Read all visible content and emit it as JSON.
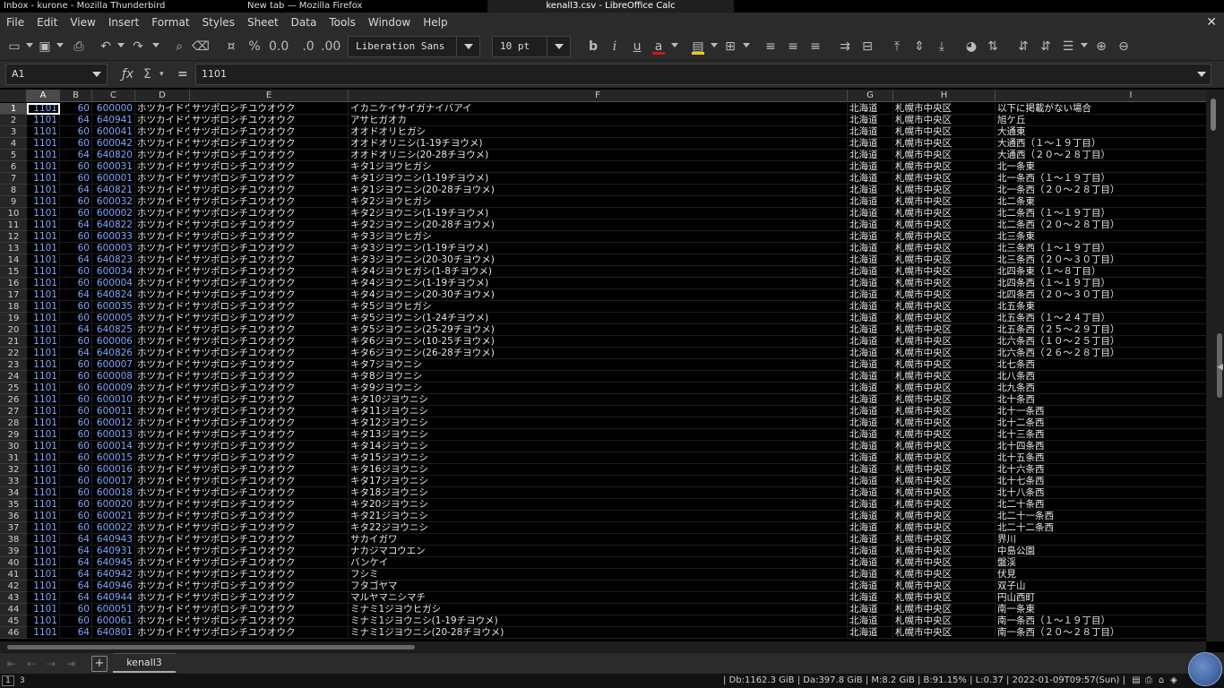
{
  "taskbar": {
    "t1": "Inbox - kurone - Mozilla Thunderbird",
    "t2": "New tab — Mozilla Firefox",
    "t3": "kenall3.csv - LibreOffice Calc"
  },
  "menu": [
    "File",
    "Edit",
    "View",
    "Insert",
    "Format",
    "Styles",
    "Sheet",
    "Data",
    "Tools",
    "Window",
    "Help"
  ],
  "close_glyph": "✕",
  "toolbar": {
    "font_name": "Liberation Sans",
    "font_size": "10 pt",
    "font_color_bar": "#d01616",
    "highlight_bar": "#e6d500"
  },
  "formula": {
    "cell_ref": "A1",
    "fx": "ƒx",
    "sigma": "Σ",
    "eq": "=",
    "value": "1101"
  },
  "columns": [
    "A",
    "B",
    "C",
    "D",
    "E",
    "F",
    "G",
    "H",
    "I"
  ],
  "rows": [
    [
      "1",
      "1101",
      "60",
      "600000",
      "ホツカイドウ",
      "サツポロシチユウオウク",
      "イカニケイサイガナイバアイ",
      "北海道",
      "札幌市中央区",
      "以下に掲載がない場合"
    ],
    [
      "2",
      "1101",
      "64",
      "640941",
      "ホツカイドウ",
      "サツポロシチユウオウク",
      "アサヒガオカ",
      "北海道",
      "札幌市中央区",
      "旭ケ丘"
    ],
    [
      "3",
      "1101",
      "60",
      "600041",
      "ホツカイドウ",
      "サツポロシチユウオウク",
      "オオドオリヒガシ",
      "北海道",
      "札幌市中央区",
      "大通東"
    ],
    [
      "4",
      "1101",
      "60",
      "600042",
      "ホツカイドウ",
      "サツポロシチユウオウク",
      "オオドオリニシ(1-19チヨウメ)",
      "北海道",
      "札幌市中央区",
      "大通西（１〜１９丁目）"
    ],
    [
      "5",
      "1101",
      "64",
      "640820",
      "ホツカイドウ",
      "サツポロシチユウオウク",
      "オオドオリニシ(20-28チヨウメ)",
      "北海道",
      "札幌市中央区",
      "大通西（２０〜２８丁目）"
    ],
    [
      "6",
      "1101",
      "60",
      "600031",
      "ホツカイドウ",
      "サツポロシチユウオウク",
      "キタ1ジヨウヒガシ",
      "北海道",
      "札幌市中央区",
      "北一条東"
    ],
    [
      "7",
      "1101",
      "60",
      "600001",
      "ホツカイドウ",
      "サツポロシチユウオウク",
      "キタ1ジヨウニシ(1-19チヨウメ)",
      "北海道",
      "札幌市中央区",
      "北一条西（１〜１９丁目）"
    ],
    [
      "8",
      "1101",
      "64",
      "640821",
      "ホツカイドウ",
      "サツポロシチユウオウク",
      "キタ1ジヨウニシ(20-28チヨウメ)",
      "北海道",
      "札幌市中央区",
      "北一条西（２０〜２８丁目）"
    ],
    [
      "9",
      "1101",
      "60",
      "600032",
      "ホツカイドウ",
      "サツポロシチユウオウク",
      "キタ2ジヨウヒガシ",
      "北海道",
      "札幌市中央区",
      "北二条東"
    ],
    [
      "10",
      "1101",
      "60",
      "600002",
      "ホツカイドウ",
      "サツポロシチユウオウク",
      "キタ2ジヨウニシ(1-19チヨウメ)",
      "北海道",
      "札幌市中央区",
      "北二条西（１〜１９丁目）"
    ],
    [
      "11",
      "1101",
      "64",
      "640822",
      "ホツカイドウ",
      "サツポロシチユウオウク",
      "キタ2ジヨウニシ(20-28チヨウメ)",
      "北海道",
      "札幌市中央区",
      "北二条西（２０〜２８丁目）"
    ],
    [
      "12",
      "1101",
      "60",
      "600033",
      "ホツカイドウ",
      "サツポロシチユウオウク",
      "キタ3ジヨウヒガシ",
      "北海道",
      "札幌市中央区",
      "北三条東"
    ],
    [
      "13",
      "1101",
      "60",
      "600003",
      "ホツカイドウ",
      "サツポロシチユウオウク",
      "キタ3ジヨウニシ(1-19チヨウメ)",
      "北海道",
      "札幌市中央区",
      "北三条西（１〜１９丁目）"
    ],
    [
      "14",
      "1101",
      "64",
      "640823",
      "ホツカイドウ",
      "サツポロシチユウオウク",
      "キタ3ジヨウニシ(20-30チヨウメ)",
      "北海道",
      "札幌市中央区",
      "北三条西（２０〜３０丁目）"
    ],
    [
      "15",
      "1101",
      "60",
      "600034",
      "ホツカイドウ",
      "サツポロシチユウオウク",
      "キタ4ジヨウヒガシ(1-8チヨウメ)",
      "北海道",
      "札幌市中央区",
      "北四条東（１〜８丁目）"
    ],
    [
      "16",
      "1101",
      "60",
      "600004",
      "ホツカイドウ",
      "サツポロシチユウオウク",
      "キタ4ジヨウニシ(1-19チヨウメ)",
      "北海道",
      "札幌市中央区",
      "北四条西（１〜１９丁目）"
    ],
    [
      "17",
      "1101",
      "64",
      "640824",
      "ホツカイドウ",
      "サツポロシチユウオウク",
      "キタ4ジヨウニシ(20-30チヨウメ)",
      "北海道",
      "札幌市中央区",
      "北四条西（２０〜３０丁目）"
    ],
    [
      "18",
      "1101",
      "60",
      "600035",
      "ホツカイドウ",
      "サツポロシチユウオウク",
      "キタ5ジヨウヒガシ",
      "北海道",
      "札幌市中央区",
      "北五条東"
    ],
    [
      "19",
      "1101",
      "60",
      "600005",
      "ホツカイドウ",
      "サツポロシチユウオウク",
      "キタ5ジヨウニシ(1-24チヨウメ)",
      "北海道",
      "札幌市中央区",
      "北五条西（１〜２４丁目）"
    ],
    [
      "20",
      "1101",
      "64",
      "640825",
      "ホツカイドウ",
      "サツポロシチユウオウク",
      "キタ5ジヨウニシ(25-29チヨウメ)",
      "北海道",
      "札幌市中央区",
      "北五条西（２５〜２９丁目）"
    ],
    [
      "21",
      "1101",
      "60",
      "600006",
      "ホツカイドウ",
      "サツポロシチユウオウク",
      "キタ6ジヨウニシ(10-25チヨウメ)",
      "北海道",
      "札幌市中央区",
      "北六条西（１０〜２５丁目）"
    ],
    [
      "22",
      "1101",
      "64",
      "640826",
      "ホツカイドウ",
      "サツポロシチユウオウク",
      "キタ6ジヨウニシ(26-28チヨウメ)",
      "北海道",
      "札幌市中央区",
      "北六条西（２６〜２８丁目）"
    ],
    [
      "23",
      "1101",
      "60",
      "600007",
      "ホツカイドウ",
      "サツポロシチユウオウク",
      "キタ7ジヨウニシ",
      "北海道",
      "札幌市中央区",
      "北七条西"
    ],
    [
      "24",
      "1101",
      "60",
      "600008",
      "ホツカイドウ",
      "サツポロシチユウオウク",
      "キタ8ジヨウニシ",
      "北海道",
      "札幌市中央区",
      "北八条西"
    ],
    [
      "25",
      "1101",
      "60",
      "600009",
      "ホツカイドウ",
      "サツポロシチユウオウク",
      "キタ9ジヨウニシ",
      "北海道",
      "札幌市中央区",
      "北九条西"
    ],
    [
      "26",
      "1101",
      "60",
      "600010",
      "ホツカイドウ",
      "サツポロシチユウオウク",
      "キタ10ジヨウニシ",
      "北海道",
      "札幌市中央区",
      "北十条西"
    ],
    [
      "27",
      "1101",
      "60",
      "600011",
      "ホツカイドウ",
      "サツポロシチユウオウク",
      "キタ11ジヨウニシ",
      "北海道",
      "札幌市中央区",
      "北十一条西"
    ],
    [
      "28",
      "1101",
      "60",
      "600012",
      "ホツカイドウ",
      "サツポロシチユウオウク",
      "キタ12ジヨウニシ",
      "北海道",
      "札幌市中央区",
      "北十二条西"
    ],
    [
      "29",
      "1101",
      "60",
      "600013",
      "ホツカイドウ",
      "サツポロシチユウオウク",
      "キタ13ジヨウニシ",
      "北海道",
      "札幌市中央区",
      "北十三条西"
    ],
    [
      "30",
      "1101",
      "60",
      "600014",
      "ホツカイドウ",
      "サツポロシチユウオウク",
      "キタ14ジヨウニシ",
      "北海道",
      "札幌市中央区",
      "北十四条西"
    ],
    [
      "31",
      "1101",
      "60",
      "600015",
      "ホツカイドウ",
      "サツポロシチユウオウク",
      "キタ15ジヨウニシ",
      "北海道",
      "札幌市中央区",
      "北十五条西"
    ],
    [
      "32",
      "1101",
      "60",
      "600016",
      "ホツカイドウ",
      "サツポロシチユウオウク",
      "キタ16ジヨウニシ",
      "北海道",
      "札幌市中央区",
      "北十六条西"
    ],
    [
      "33",
      "1101",
      "60",
      "600017",
      "ホツカイドウ",
      "サツポロシチユウオウク",
      "キタ17ジヨウニシ",
      "北海道",
      "札幌市中央区",
      "北十七条西"
    ],
    [
      "34",
      "1101",
      "60",
      "600018",
      "ホツカイドウ",
      "サツポロシチユウオウク",
      "キタ18ジヨウニシ",
      "北海道",
      "札幌市中央区",
      "北十八条西"
    ],
    [
      "35",
      "1101",
      "60",
      "600020",
      "ホツカイドウ",
      "サツポロシチユウオウク",
      "キタ20ジヨウニシ",
      "北海道",
      "札幌市中央区",
      "北二十条西"
    ],
    [
      "36",
      "1101",
      "60",
      "600021",
      "ホツカイドウ",
      "サツポロシチユウオウク",
      "キタ21ジヨウニシ",
      "北海道",
      "札幌市中央区",
      "北二十一条西"
    ],
    [
      "37",
      "1101",
      "60",
      "600022",
      "ホツカイドウ",
      "サツポロシチユウオウク",
      "キタ22ジヨウニシ",
      "北海道",
      "札幌市中央区",
      "北二十二条西"
    ],
    [
      "38",
      "1101",
      "64",
      "640943",
      "ホツカイドウ",
      "サツポロシチユウオウク",
      "サカイガワ",
      "北海道",
      "札幌市中央区",
      "界川"
    ],
    [
      "39",
      "1101",
      "64",
      "640931",
      "ホツカイドウ",
      "サツポロシチユウオウク",
      "ナカジマコウエン",
      "北海道",
      "札幌市中央区",
      "中島公園"
    ],
    [
      "40",
      "1101",
      "64",
      "640945",
      "ホツカイドウ",
      "サツポロシチユウオウク",
      "バンケイ",
      "北海道",
      "札幌市中央区",
      "盤渓"
    ],
    [
      "41",
      "1101",
      "64",
      "640942",
      "ホツカイドウ",
      "サツポロシチユウオウク",
      "フシミ",
      "北海道",
      "札幌市中央区",
      "伏見"
    ],
    [
      "42",
      "1101",
      "64",
      "640946",
      "ホツカイドウ",
      "サツポロシチユウオウク",
      "フタゴヤマ",
      "北海道",
      "札幌市中央区",
      "双子山"
    ],
    [
      "43",
      "1101",
      "64",
      "640944",
      "ホツカイドウ",
      "サツポロシチユウオウク",
      "マルヤマニシマチ",
      "北海道",
      "札幌市中央区",
      "円山西町"
    ],
    [
      "44",
      "1101",
      "60",
      "600051",
      "ホツカイドウ",
      "サツポロシチユウオウク",
      "ミナミ1ジヨウヒガシ",
      "北海道",
      "札幌市中央区",
      "南一条東"
    ],
    [
      "45",
      "1101",
      "60",
      "600061",
      "ホツカイドウ",
      "サツポロシチユウオウク",
      "ミナミ1ジヨウニシ(1-19チヨウメ)",
      "北海道",
      "札幌市中央区",
      "南一条西（１〜１９丁目）"
    ],
    [
      "46",
      "1101",
      "64",
      "640801",
      "ホツカイドウ",
      "サツポロシチユウオウク",
      "ミナミ1ジヨウニシ(20-28チヨウメ)",
      "北海道",
      "札幌市中央区",
      "南一条西（２０〜２８丁目）"
    ]
  ],
  "sheet_tab": "kenall3",
  "status": {
    "workspace_active": "1",
    "workspace_other": "3",
    "sysinfo": "| Db:1162.3 GiB | Da:397.8 GiB | M:8.2 GiB | B:91.15% | L:0.37 | 2022-01-09T09:57(Sun) |"
  }
}
